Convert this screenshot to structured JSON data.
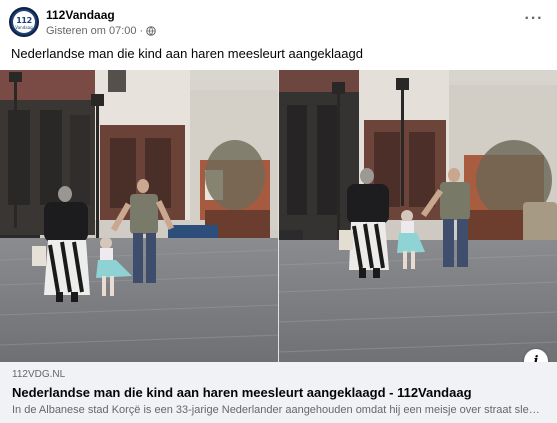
{
  "post": {
    "page_name": "112Vandaag",
    "avatar_text": "112",
    "avatar_subtext": "Vandaag",
    "timestamp": "Gisteren om 07:00",
    "separator": "·",
    "privacy_icon": "globe-icon",
    "more_icon": "more-options-icon",
    "more_label": "···",
    "caption": "Nederlandse man die kind aan haren meesleurt aangeklaagd"
  },
  "media": {
    "frames": [
      "video-still-left",
      "video-still-right"
    ],
    "info_icon": "info-icon",
    "info_label": "i"
  },
  "link_preview": {
    "domain": "112VDG.NL",
    "title": "Nederlandse man die kind aan haren meesleurt aangeklaagd - 112Vandaag",
    "description": "In de Albanese stad Korçë is een 33-jarige Nederlander aangehouden omdat hij een meisje over straat sleurde"
  },
  "colors": {
    "brand": "#1c3f74",
    "text_secondary": "#65676b",
    "link_bg": "#f0f2f5"
  }
}
